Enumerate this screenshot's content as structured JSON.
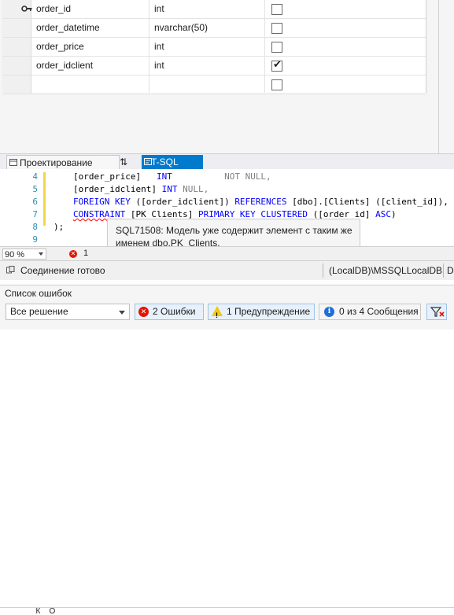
{
  "designer": {
    "rows": [
      {
        "name": "order_id",
        "type": "int",
        "nullable": false,
        "primary_key": true
      },
      {
        "name": "order_datetime",
        "type": "nvarchar(50)",
        "nullable": false
      },
      {
        "name": "order_price",
        "type": "int",
        "nullable": false
      },
      {
        "name": "order_idclient",
        "type": "int",
        "nullable": true
      },
      {
        "name": "",
        "type": "",
        "nullable": false
      }
    ],
    "icons": {
      "primary_key": "key-icon"
    }
  },
  "tabs": {
    "design": "Проектирование",
    "swap": "⇅",
    "tsql": "T-SQL"
  },
  "editor": {
    "lines": [
      {
        "num": "4",
        "text": "[order_price]   INT          NOT NULL,"
      },
      {
        "num": "5",
        "text": "[order_idclient] INT NULL,"
      },
      {
        "num": "6",
        "text": "FOREIGN KEY ([order_idclient]) REFERENCES [dbo].[Clients] ([client_id]),"
      },
      {
        "num": "7",
        "text": "CONSTRAINT [PK_Clients] PRIMARY KEY CLUSTERED ([order_id] ASC)"
      },
      {
        "num": "8",
        "text": ");"
      },
      {
        "num": "9",
        "text": ""
      }
    ],
    "tooltip_line1": "SQL71508: Модель уже содержит элемент с таким же",
    "tooltip_line2": "именем dbo.PK_Clients."
  },
  "zoom": {
    "level": "90 %",
    "error_count": "1"
  },
  "status": {
    "text": "Соединение готово",
    "server": "(LocalDB)\\MSSQLLocalDB",
    "more": "DE"
  },
  "error_list": {
    "title": "Список ошибок",
    "scope": "Все решение",
    "errors_label": "2 Ошибки",
    "warnings_label": "1 Предупреждение",
    "messages_label": "0 из 4 Сообщения",
    "columns_fragment": "  К    О"
  },
  "colors": {
    "accent": "#007acc",
    "error": "#e51400",
    "warning": "#f2c811",
    "keyword": "#0000ff",
    "line_number": "#2b91af"
  }
}
